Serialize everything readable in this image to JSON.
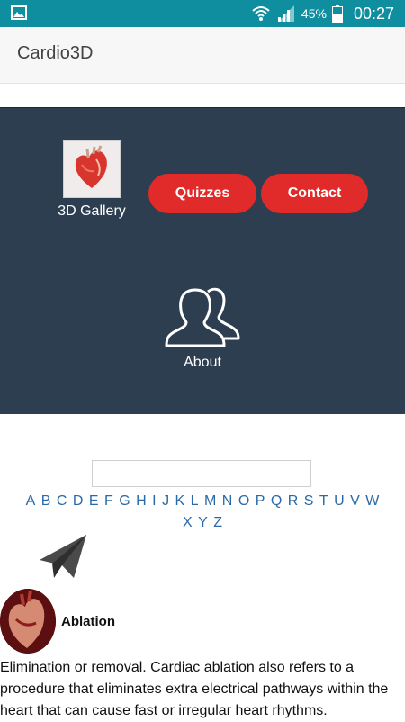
{
  "status_bar": {
    "battery_percent": "45%",
    "time": "00:27",
    "icons": [
      "gallery-icon",
      "wifi-icon",
      "signal-icon",
      "battery-icon"
    ]
  },
  "app_bar": {
    "title": "Cardio3D"
  },
  "menu": {
    "gallery_label": "3D Gallery",
    "quizzes_label": "Quizzes",
    "contact_label": "Contact",
    "about_label": "About",
    "accent_color": "#e12a2a",
    "panel_color": "#2d3e50"
  },
  "search": {
    "value": "",
    "placeholder": ""
  },
  "alphabet": [
    "A",
    "B",
    "C",
    "D",
    "E",
    "F",
    "G",
    "H",
    "I",
    "J",
    "K",
    "L",
    "M",
    "N",
    "O",
    "P",
    "Q",
    "R",
    "S",
    "T",
    "U",
    "V",
    "W",
    "X",
    "Y",
    "Z"
  ],
  "entry": {
    "term": "Ablation",
    "definition": "Elimination or removal. Cardiac ablation also refers to a procedure that eliminates extra electrical pathways within the heart that can cause fast or irregular heart rhythms."
  }
}
